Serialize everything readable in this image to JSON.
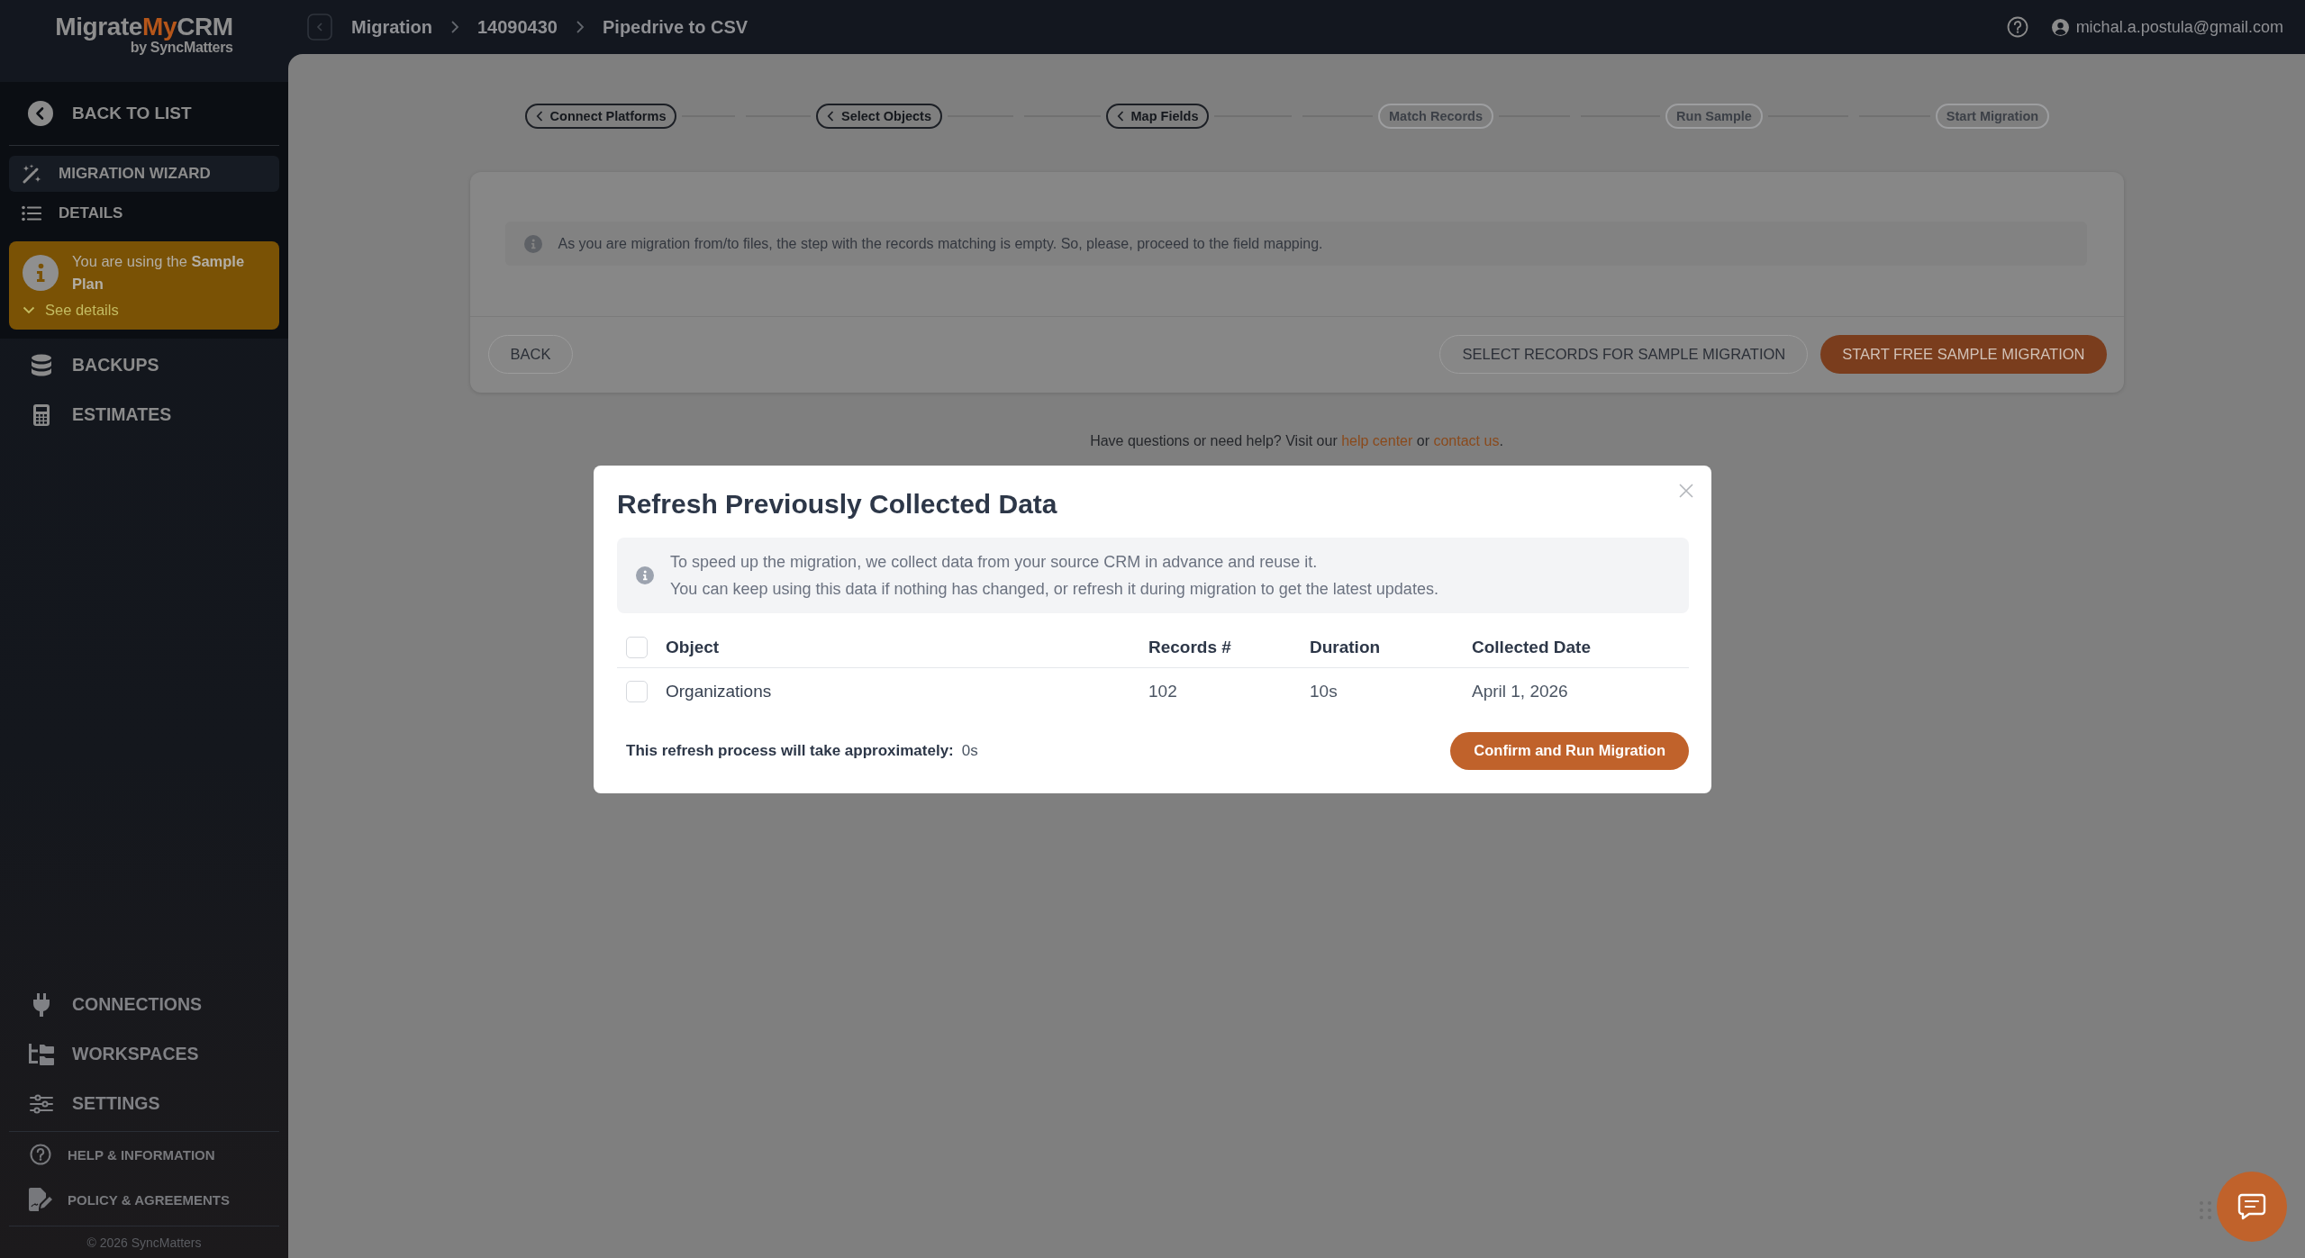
{
  "header": {
    "logo": {
      "parts": [
        {
          "text": "Migrate",
          "accent": false
        },
        {
          "text": "My",
          "accent": true
        },
        {
          "text": "CRM",
          "accent": false
        }
      ],
      "tagline": "by SyncMatters"
    },
    "breadcrumbs": [
      "Migration",
      "14090430",
      "Pipedrive to CSV"
    ],
    "user_email": "michal.a.postula@gmail.com"
  },
  "sidebar": {
    "back_link": "BACK TO LIST",
    "wizard_menu": [
      {
        "label": "MIGRATION WIZARD",
        "selected": true
      },
      {
        "label": "DETAILS",
        "selected": false
      }
    ],
    "plan_notice": {
      "text": "You are using the **Sample Plan**",
      "toggle": "See details"
    },
    "main_menu": [
      "BACKUPS",
      "ESTIMATES"
    ],
    "bottom_menu": [
      "CONNECTIONS",
      "WORKSPACES",
      "SETTINGS"
    ],
    "footer_links": [
      "HELP & INFORMATION",
      "POLICY & AGREEMENTS"
    ],
    "copyright": "© 2026 SyncMatters"
  },
  "stepper": [
    {
      "label": "Connect Platforms",
      "completed": true
    },
    {
      "label": "Select Objects",
      "completed": true
    },
    {
      "label": "Map Fields",
      "completed": true
    },
    {
      "label": "Match Records",
      "completed": false
    },
    {
      "label": "Run Sample",
      "completed": false
    },
    {
      "label": "Start Migration",
      "completed": false
    }
  ],
  "card": {
    "notice": "As you are migration from/to files, the step with the records matching is empty. So, please, proceed to the field mapping.",
    "back_button": "BACK",
    "secondary_button": "SELECT RECORDS FOR SAMPLE MIGRATION",
    "primary_button": "START FREE SAMPLE MIGRATION"
  },
  "help_line": [
    {
      "kind": "text",
      "text": "Have questions or need help? Visit our "
    },
    {
      "kind": "link",
      "text": "help center"
    },
    {
      "kind": "text",
      "text": " or "
    },
    {
      "kind": "link",
      "text": "contact us"
    },
    {
      "kind": "text",
      "text": "."
    }
  ],
  "modal": {
    "title": "Refresh Previously Collected Data",
    "info_lines": [
      "To speed up the migration, we collect data from your source CRM in advance and reuse it.",
      "You can keep using this data if nothing has changed, or refresh it during migration to get the latest updates."
    ],
    "table": {
      "columns": [
        "Object",
        "Records #",
        "Duration",
        "Collected Date"
      ],
      "all_checked": false,
      "rows": [
        {
          "checked": false,
          "cells": [
            "Organizations",
            "102",
            "10s",
            "April 1, 2026"
          ]
        }
      ]
    },
    "estimate_label": "This refresh process will take approximately:",
    "estimate_value": "0s",
    "confirm_button": "Confirm and Run Migration"
  }
}
